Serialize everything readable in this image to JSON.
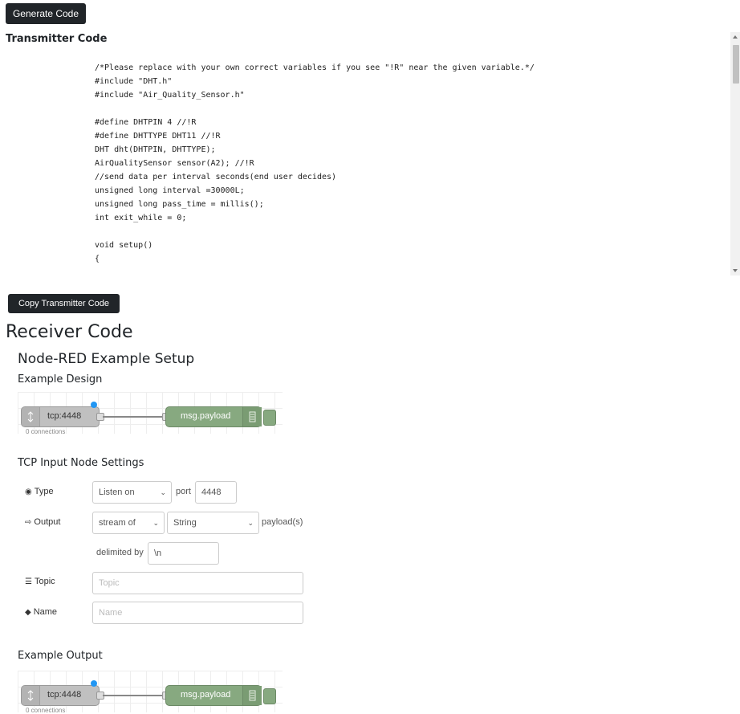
{
  "generate_button": "Generate Code",
  "transmitter": {
    "title": "Transmitter Code",
    "code_lines": [
      "/*Please replace with your own correct variables if you see \"!R\" near the given variable.*/",
      "#include \"DHT.h\"",
      "#include \"Air_Quality_Sensor.h\"",
      "",
      "#define DHTPIN 4 //!R",
      "#define DHTTYPE DHT11 //!R",
      "DHT dht(DHTPIN, DHTTYPE);",
      "AirQualitySensor sensor(A2); //!R",
      "//send data per interval seconds(end user decides)",
      "unsigned long interval =30000L;",
      "unsigned long pass_time = millis();",
      "int exit_while = 0;",
      "",
      "void setup()",
      "{"
    ],
    "copy_button": "Copy Transmitter Code"
  },
  "receiver": {
    "title": "Receiver Code",
    "node_red_title": "Node-RED Example Setup",
    "example_design": "Example Design",
    "flow": {
      "input_node": "tcp:4448",
      "connections": "0 connections",
      "output_node": "msg.payload"
    },
    "tcp_settings_title": "TCP Input Node Settings",
    "form": {
      "type_label": "Type",
      "type_value": "Listen on",
      "port_label": "port",
      "port_value": "4448",
      "output_label": "Output",
      "output_mode": "stream of",
      "output_type": "String",
      "payloads_label": "payload(s)",
      "delimited_label": "delimited by",
      "delimiter_value": "\\n",
      "topic_label": "Topic",
      "topic_placeholder": "Topic",
      "name_label": "Name",
      "name_placeholder": "Name"
    },
    "example_output": "Example Output"
  },
  "icons": {
    "type": "target-icon",
    "output": "sign-out-icon",
    "topic": "tasks-icon",
    "name": "tag-icon",
    "tcp": "tcp-node-icon",
    "debug": "debug-list-icon"
  },
  "colors": {
    "button_bg": "#212529",
    "debug_node": "#87a980",
    "tcp_node": "#c0c0c0",
    "selected_dot": "#2196f3"
  }
}
